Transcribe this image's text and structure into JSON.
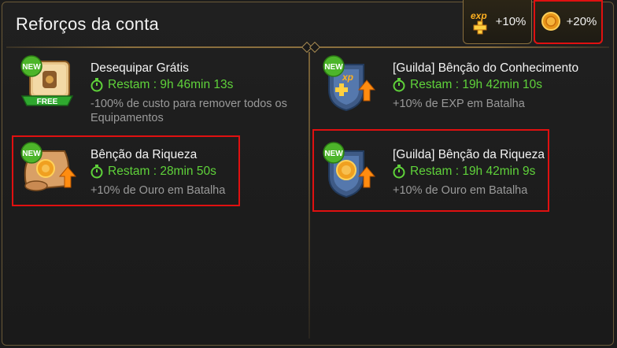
{
  "header": {
    "title": "Reforços da conta"
  },
  "boost_tabs": [
    {
      "label": "+10%",
      "icon": "exp-plus-icon",
      "selected": false
    },
    {
      "label": "+20%",
      "icon": "gold-coin-icon",
      "selected": true
    }
  ],
  "left_column": [
    {
      "name": "Desequipar Grátis",
      "timer": "Restam : 9h 46min 13s",
      "desc": "-100% de custo para remover todos os Equipamentos",
      "badge": "NEW",
      "ribbon": "FREE",
      "icon": "free-unequip-scroll-icon",
      "highlighted": false
    },
    {
      "name": "Bênção da Riqueza",
      "timer": "Restam : 28min 50s",
      "desc": "+10% de Ouro em Batalha",
      "badge": "NEW",
      "icon": "gold-scroll-icon",
      "highlighted": true
    }
  ],
  "right_column": [
    {
      "name": "[Guilda] Bênção do Conhecimento",
      "timer": "Restam : 19h 42min 10s",
      "desc": "+10% de EXP em Batalha",
      "badge": "NEW",
      "icon": "guild-exp-shield-icon",
      "highlighted": false
    },
    {
      "name": "[Guilda] Bênção da Riqueza",
      "timer": "Restam : 19h 42min 9s",
      "desc": "+10% de Ouro em Batalha",
      "badge": "NEW",
      "icon": "guild-gold-shield-icon",
      "highlighted": true
    }
  ],
  "colors": {
    "timer_green": "#5fd23a",
    "highlight_red": "#e01010",
    "frame_gold": "#8a6f3e"
  }
}
